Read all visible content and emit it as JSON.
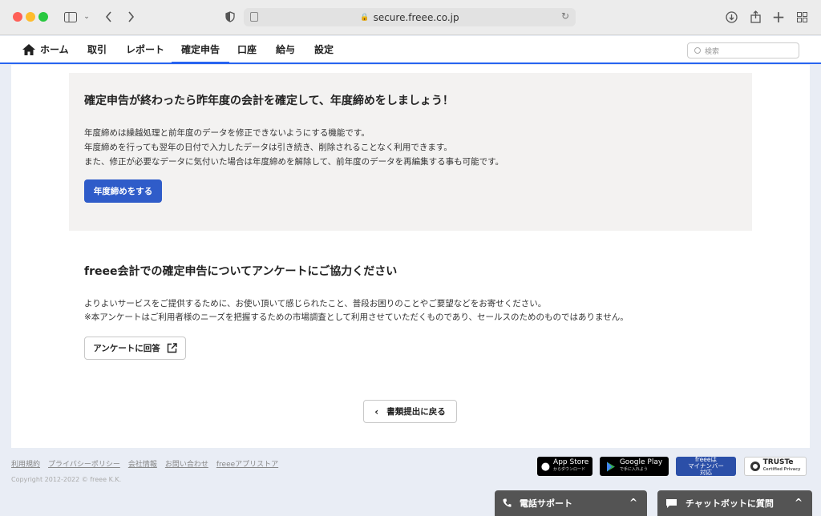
{
  "browser": {
    "url": "secure.freee.co.jp"
  },
  "nav": {
    "items": [
      {
        "label": "ホーム"
      },
      {
        "label": "取引"
      },
      {
        "label": "レポート"
      },
      {
        "label": "確定申告"
      },
      {
        "label": "口座"
      },
      {
        "label": "給与"
      },
      {
        "label": "設定"
      }
    ],
    "active": "確定申告",
    "search_placeholder": "検索"
  },
  "notice": {
    "title": "確定申告が終わったら昨年度の会計を確定して、年度締めをしましょう！",
    "lines": [
      "年度締めは繰越処理と前年度のデータを修正できないようにする機能です。",
      "年度締めを行っても翌年の日付で入力したデータは引き続き、削除されることなく利用できます。",
      "また、修正が必要なデータに気付いた場合は年度締めを解除して、前年度のデータを再編集する事も可能です。"
    ],
    "button_label": "年度締めをする"
  },
  "survey": {
    "title": "freee会計での確定申告についてアンケートにご協力ください",
    "lines": [
      "よりよいサービスをご提供するために、お使い頂いて感じられたこと、普段お困りのことやご要望などをお寄せください。",
      "※本アンケートはご利用者様のニーズを把握するための市場調査として利用させていただくものであり、セールスのためのものではありません。"
    ],
    "button_label": "アンケートに回答"
  },
  "back_button_label": "書類提出に戻る",
  "footer": {
    "links": [
      "利用規約",
      "プライバシーポリシー",
      "会社情報",
      "お問い合わせ",
      "freeeアプリストア"
    ],
    "copyright": "Copyright 2012-2022 © freee K.K.",
    "badges": {
      "app_store": "App Store",
      "app_store_sub": "からダウンロード",
      "google_play": "Google Play",
      "google_play_sub": "で手に入れよう",
      "mynumber_1": "freeeは",
      "mynumber_2": "マイナンバー",
      "mynumber_3": "対応",
      "truste": "TRUSTe",
      "truste_sub": "Certified Privacy"
    }
  },
  "support": {
    "phone_label": "電話サポート",
    "chat_label": "チャットボットに質問"
  },
  "colors": {
    "accent": "#2864f0",
    "primary_button": "#2f5cc9",
    "support_bar": "#545454"
  }
}
